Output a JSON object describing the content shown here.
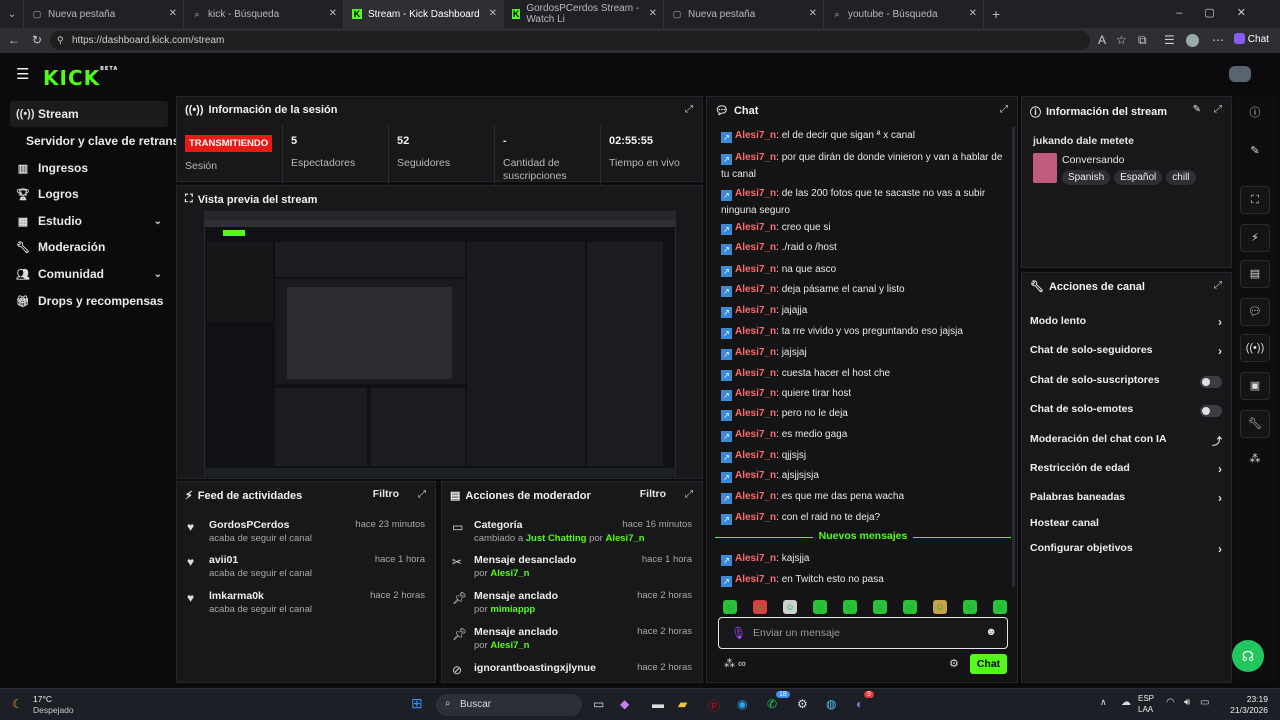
{
  "browser": {
    "tabs": [
      {
        "label": "Nueva pestaña",
        "icon": "page-icon"
      },
      {
        "label": "kick - Búsqueda",
        "icon": "search-icon"
      },
      {
        "label": "Stream - Kick Dashboard",
        "icon": "kick-icon"
      },
      {
        "label": "GordosPCerdos Stream - Watch Li",
        "icon": "kick-icon"
      },
      {
        "label": "Nueva pestaña",
        "icon": "page-icon"
      },
      {
        "label": "youtube - Búsqueda",
        "icon": "search-icon"
      }
    ],
    "url": "https://dashboard.kick.com/stream",
    "copilot_label": "Chat"
  },
  "header": {
    "logo": "KICK",
    "beta": "BETA"
  },
  "sidebar": {
    "items": [
      {
        "label": "Stream",
        "icon": "stream-icon"
      },
      {
        "label": "Servidor y clave de retransm",
        "icon": ""
      },
      {
        "label": "Ingresos",
        "icon": "chart-icon"
      },
      {
        "label": "Logros",
        "icon": "trophy-icon"
      },
      {
        "label": "Estudio",
        "icon": "grid-icon"
      },
      {
        "label": "Moderación",
        "icon": "wrench-icon"
      },
      {
        "label": "Comunidad",
        "icon": "people-icon"
      },
      {
        "label": "Drops y recompensas",
        "icon": "gift-icon"
      }
    ]
  },
  "session": {
    "title": "Información de la sesión",
    "live_badge": "TRANSMITIENDO",
    "stats": [
      {
        "value": "",
        "label": "Sesión"
      },
      {
        "value": "5",
        "label": "Espectadores"
      },
      {
        "value": "52",
        "label": "Seguidores"
      },
      {
        "value": "-",
        "label": "Cantidad de suscripciones"
      },
      {
        "value": "02:55:55",
        "label": "Tiempo en vivo"
      }
    ]
  },
  "preview": {
    "title": "Vista previa del stream"
  },
  "feed": {
    "title": "Feed de actividades",
    "filter": "Filtro",
    "items": [
      {
        "name": "GordosPCerdos",
        "sub": "acaba de seguir el canal",
        "time": "hace 23 minutos"
      },
      {
        "name": "avii01",
        "sub": "acaba de seguir el canal",
        "time": "hace 1 hora"
      },
      {
        "name": "lmkarma0k",
        "sub": "acaba de seguir el canal",
        "time": "hace 2 horas"
      }
    ]
  },
  "modactions": {
    "title": "Acciones de moderador",
    "filter": "Filtro",
    "items": [
      {
        "title": "Categoría",
        "pre": "cambiado a ",
        "hl": "Just Chatting",
        "mid": " por ",
        "user": "Alesi7_n",
        "time": "hace 16 minutos",
        "icon": "category-icon"
      },
      {
        "title": "Mensaje desanclado",
        "pre": "por ",
        "hl": "",
        "mid": "",
        "user": "Alesi7_n",
        "time": "hace 1 hora",
        "icon": "unpin-icon"
      },
      {
        "title": "Mensaje anclado",
        "pre": "por ",
        "hl": "",
        "mid": "",
        "user": "mimiappp",
        "time": "hace 2 horas",
        "icon": "pin-icon"
      },
      {
        "title": "Mensaje anclado",
        "pre": "por ",
        "hl": "",
        "mid": "",
        "user": "Alesi7_n",
        "time": "hace 2 horas",
        "icon": "pin-icon"
      },
      {
        "title": "ignorantboastingxjlynue",
        "pre": "",
        "hl": "",
        "mid": "",
        "user": "",
        "time": "hace 2 horas",
        "icon": "ban-icon"
      }
    ]
  },
  "chat": {
    "title": "Chat",
    "user": "Alesi7_n",
    "messages": [
      "el de decir que sigan ª x canal",
      "por que dirán de donde vinieron y van a hablar de tu canal",
      "de las 200 fotos que te sacaste no vas a subir ninguna seguro",
      "creo que si",
      "./raid o /host",
      "na que asco",
      "deja pásame el canal y listo",
      "jajajja",
      "ta rre vivido y vos preguntando eso jajsja",
      "jajsjaj",
      "cuesta hacer el host che",
      "quiere tirar host",
      "pero no le deja",
      "es medio gaga",
      "qjjsjsj",
      "ajsjjsjsja",
      "es que me das pena wacha",
      "con el raid no te deja?"
    ],
    "new_divider": "Nuevos mensajes",
    "new_messages": [
      "kajsjja",
      "en Twitch esto no pasa"
    ],
    "input_placeholder": "Enviar un mensaje",
    "send_label": "Chat"
  },
  "stream_info": {
    "title": "Información del stream",
    "stream_title": "jukando dale metete",
    "category": "Conversando",
    "tags": [
      "Spanish",
      "Español",
      "chill"
    ]
  },
  "channel_actions": {
    "title": "Acciones de canal",
    "items": [
      {
        "label": "Modo lento",
        "control": "arrow"
      },
      {
        "label": "Chat de solo-seguidores",
        "control": "arrow"
      },
      {
        "label": "Chat de solo-suscriptores",
        "control": "toggle"
      },
      {
        "label": "Chat de solo-emotes",
        "control": "toggle"
      },
      {
        "label": "Moderación del chat con IA",
        "control": "external"
      },
      {
        "label": "Restricción de edad",
        "control": "arrow"
      },
      {
        "label": "Palabras baneadas",
        "control": "arrow"
      },
      {
        "label": "Hostear canal",
        "control": "none"
      },
      {
        "label": "Configurar objetivos",
        "control": "arrow"
      }
    ]
  },
  "taskbar": {
    "weather_temp": "17°C",
    "weather_text": "Despejado",
    "search": "Buscar",
    "lang1": "ESP",
    "lang2": "LAA",
    "time": "23:19",
    "date": "21/3/2026",
    "badge1": "18",
    "badge2": "9"
  }
}
